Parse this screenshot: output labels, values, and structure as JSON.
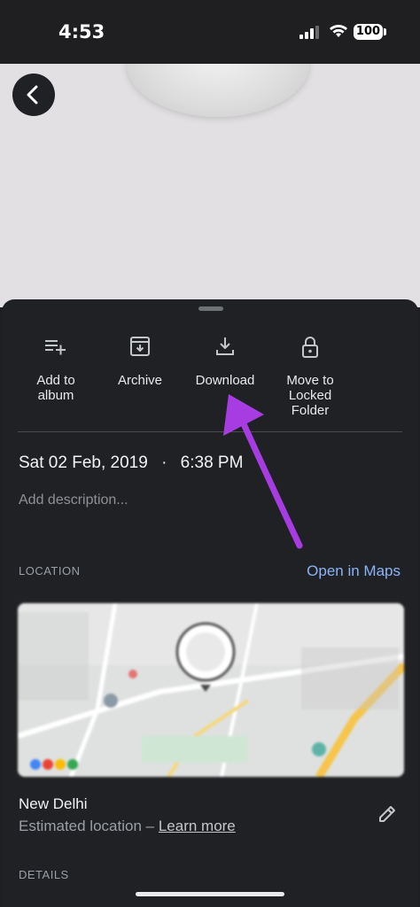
{
  "status_bar": {
    "time": "4:53",
    "battery": "100"
  },
  "actions": [
    {
      "label": "Add to\nalbum",
      "icon": "playlist-add-icon"
    },
    {
      "label": "Archive",
      "icon": "archive-icon"
    },
    {
      "label": "Download",
      "icon": "download-icon"
    },
    {
      "label": "Move to\nLocked\nFolder",
      "icon": "lock-icon"
    }
  ],
  "info": {
    "date": "Sat 02 Feb, 2019",
    "separator": "·",
    "time": "6:38 PM",
    "description_placeholder": "Add description..."
  },
  "location": {
    "section_label": "LOCATION",
    "open_maps": "Open in Maps",
    "city": "New Delhi",
    "estimated": "Estimated location –",
    "learn_more": "Learn more"
  },
  "details": {
    "section_label": "DETAILS"
  },
  "colors": {
    "sheet_bg": "#202124",
    "link": "#8ab4f8",
    "annotation_arrow": "#a83ce3"
  }
}
